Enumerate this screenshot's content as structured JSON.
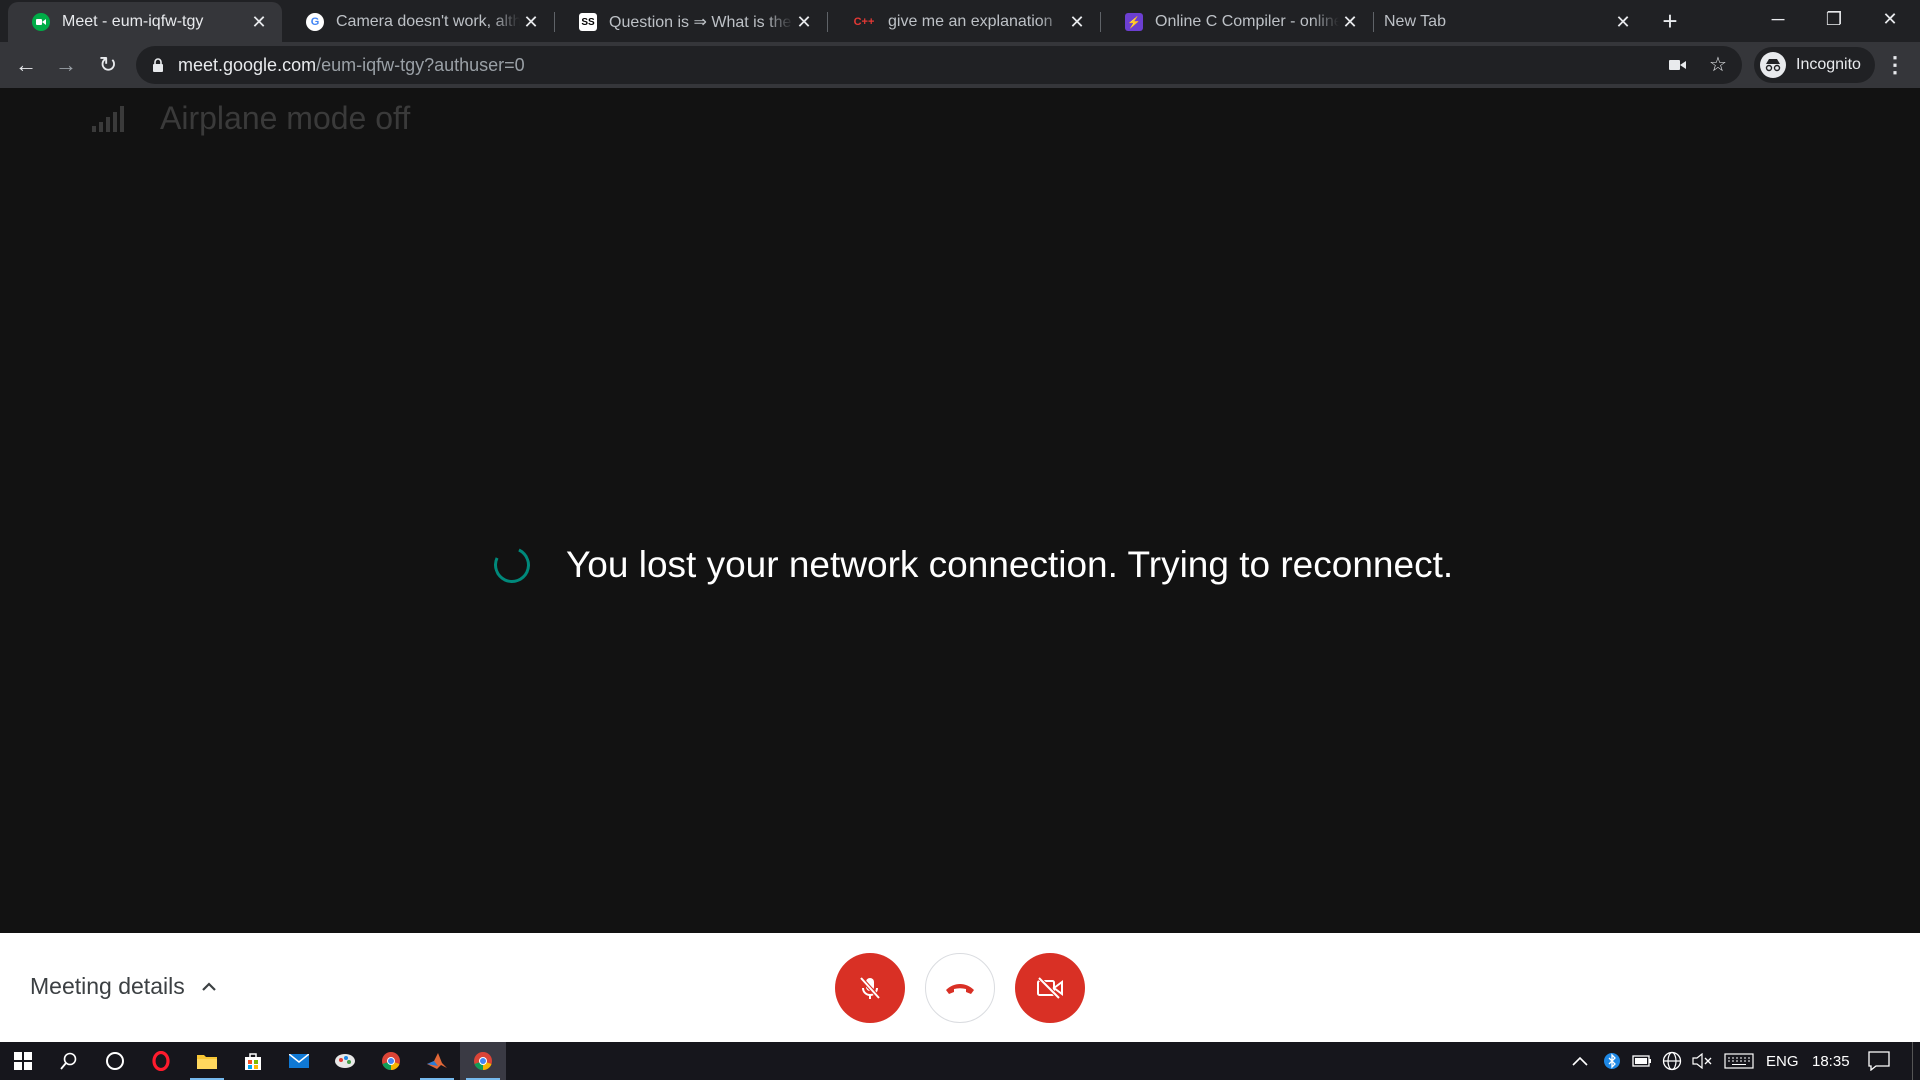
{
  "browser": {
    "tabs": [
      {
        "title": "Meet - eum-iqfw-tgy",
        "favicon": "meet-icon",
        "active": true
      },
      {
        "title": "Camera doesn't work, although",
        "favicon": "google-icon",
        "active": false
      },
      {
        "title": "Question is ⇒ What is the co",
        "favicon": "ss-icon",
        "active": false
      },
      {
        "title": "give me an explanation",
        "favicon": "cpp-icon",
        "active": false
      },
      {
        "title": "Online C Compiler - online ed",
        "favicon": "compiler-icon",
        "active": false
      },
      {
        "title": "New Tab",
        "favicon": "",
        "active": false
      }
    ],
    "url_host": "meet.google.com",
    "url_path": "/eum-iqfw-tgy?authuser=0",
    "profile_label": "Incognito"
  },
  "overlay": {
    "airplane_text": "Airplane mode off"
  },
  "main": {
    "status_message": "You lost your network connection. Trying to reconnect."
  },
  "bottom_bar": {
    "meeting_details_label": "Meeting details"
  },
  "taskbar": {
    "language": "ENG",
    "time": "18:35"
  },
  "colors": {
    "accent_red": "#d93025",
    "spinner_teal": "#00897b",
    "background": "#121212"
  }
}
